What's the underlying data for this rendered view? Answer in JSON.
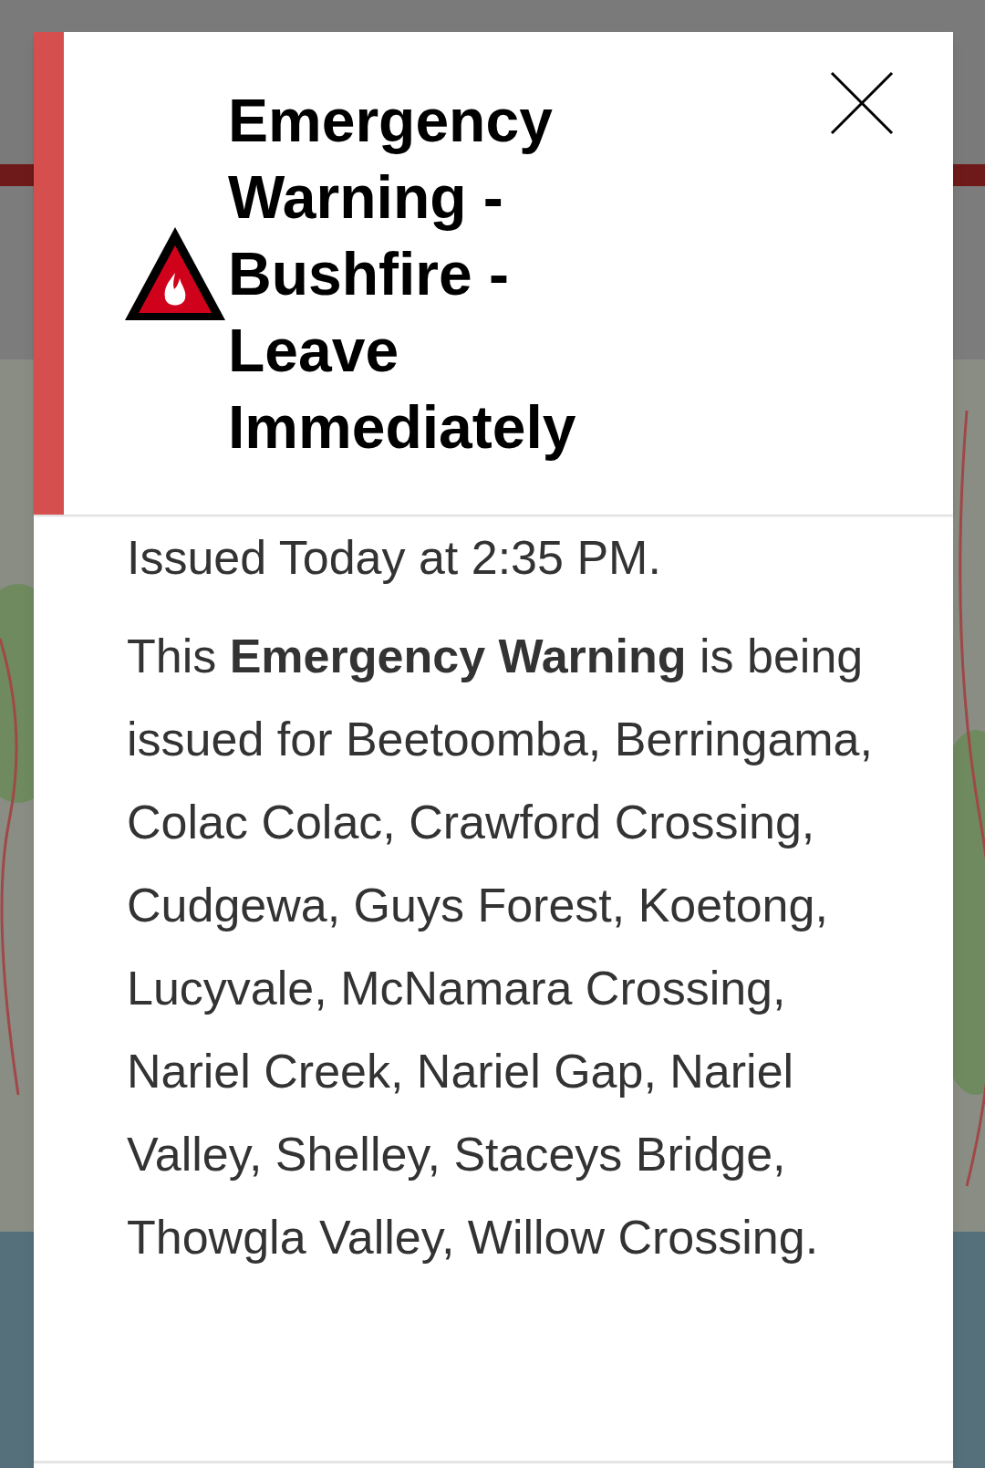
{
  "alert": {
    "title": "Emergency Warning - Bushfire - Leave Immediately",
    "issued": "Issued Today at 2:35 PM.",
    "message": "This **Emergency Warning** is being issued for Beetoomba, Berringama, Colac Colac, Crawford Crossing, Cudgewa, Guys Forest, Koetong, Lucyvale, McNamara Crossing, Nariel Creek, Nariel Gap, Nariel Valley, Shelley, Staceys Bridge, Thowgla Valley, Willow Crossing."
  }
}
